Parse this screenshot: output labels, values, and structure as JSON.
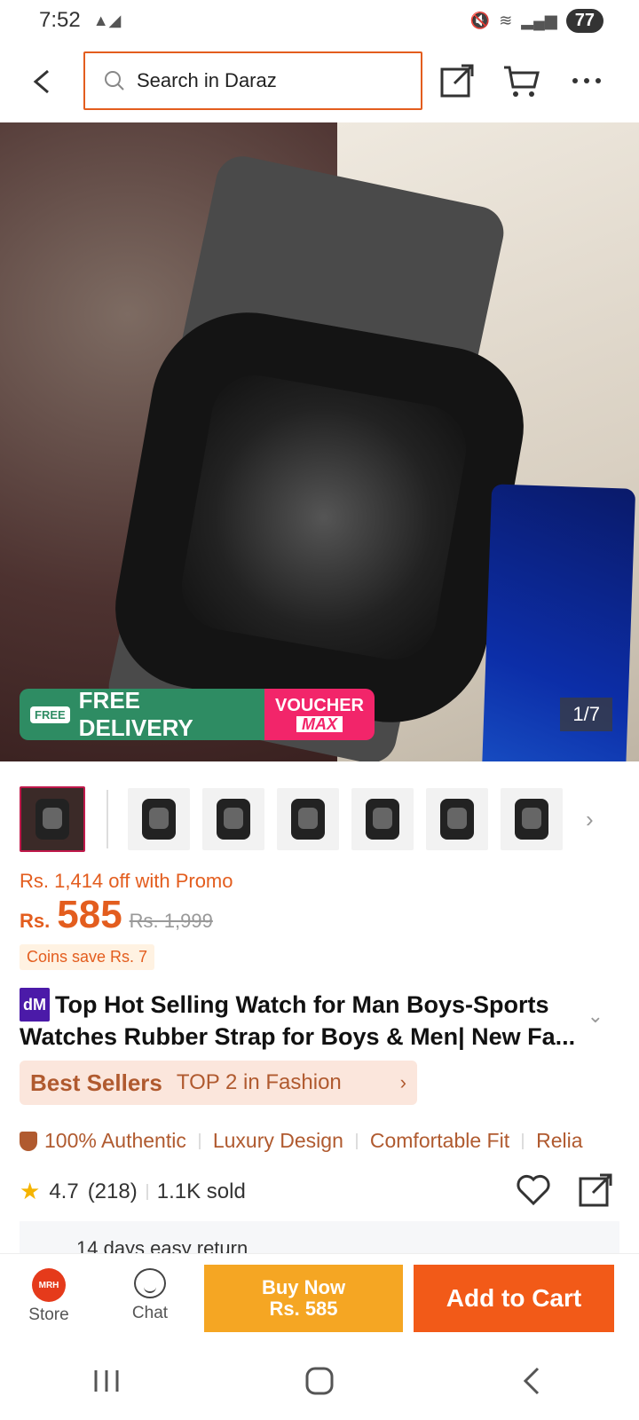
{
  "status_bar": {
    "time": "7:52",
    "battery": "77"
  },
  "search": {
    "placeholder": "Search in Daraz"
  },
  "gallery": {
    "counter": "1/7",
    "promo_free": "FREE DELIVERY",
    "promo_free_badge": "FREE",
    "promo_voucher_line1": "VOUCHER",
    "promo_voucher_line2": "MAX",
    "thumb_colors": [
      "#2a4a9a",
      "#1f6b2c",
      "#f2d21b",
      "#ef6a1a",
      "#c9202a",
      "#5a5a5a"
    ]
  },
  "price": {
    "promo_text": "Rs. 1,414 off with Promo",
    "currency": "Rs.",
    "value": "585",
    "old_price": "Rs. 1,999",
    "coins_text": "Coins save Rs. 7"
  },
  "product": {
    "badge": "dM",
    "title": "Top Hot Selling Watch for Man Boys-Sports Watches Rubber Strap for Boys & Men| New Fa..."
  },
  "best_sellers": {
    "title": "Best Sellers",
    "subtitle": "TOP 2 in Fashion"
  },
  "features": [
    "100% Authentic",
    "Luxury Design",
    "Comfortable Fit",
    "Relia"
  ],
  "rating": {
    "score": "4.7",
    "count": "(218)",
    "sold": "1.1K sold"
  },
  "return_policy": {
    "text": "14 days easy return"
  },
  "bottom_bar": {
    "store_label": "Store",
    "store_logo": "MRH",
    "chat_label": "Chat",
    "buy_now_line1": "Buy Now",
    "buy_now_line2": "Rs. 585",
    "add_to_cart": "Add to Cart"
  },
  "colors": {
    "accent": "#e35d1e",
    "buy_now": "#f5a623",
    "add_to_cart": "#f25a18"
  }
}
